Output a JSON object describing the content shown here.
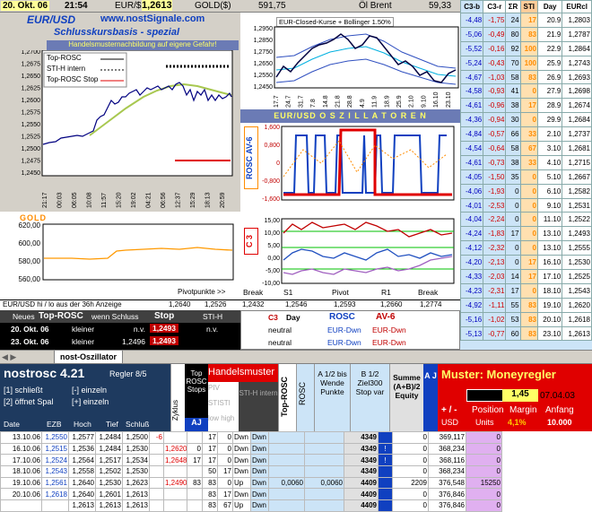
{
  "topbar": {
    "date": "20. Okt. 06",
    "time": "21:54",
    "eur_label": "EUR/$",
    "eur_value": "1,2613",
    "gold_label": "GOLD($)",
    "gold_value": "591,75",
    "oil_label": "Öl Brent",
    "oil_value": "59,33"
  },
  "main_chart": {
    "pair": "EUR/USD",
    "site": "www.nostSignale.com",
    "subtitle": "Schlusskursbasis - spezial",
    "banner": "Handelsmusternachbildung auf eigene Gefahr!",
    "legend": [
      "Top-ROSC",
      "STI-H intern",
      "Top-ROSC Stop"
    ],
    "yticks": [
      "1,2700",
      "1,2675",
      "1,2650",
      "1,2625",
      "1,2600",
      "1,2575",
      "1,2550",
      "1,2525",
      "1,2500",
      "1,2475",
      "1,2450"
    ],
    "xticks": [
      "21:17",
      "00:03",
      "06:05",
      "10:08",
      "11:57",
      "15:20",
      "19:02",
      "04:21",
      "06:56",
      "12:37",
      "15:29",
      "18:13",
      "20:59"
    ]
  },
  "gold_chart": {
    "title": "GOLD",
    "yticks": [
      "620,00",
      "600,00",
      "580,00",
      "560,00"
    ],
    "pivot_label": "Pivotpunkte >>"
  },
  "boll_chart": {
    "title": "EUR-Closed-Kurse + Bollinger 1.50%",
    "yticks": [
      "1,2950",
      "1,2850",
      "1,2750",
      "1,2650",
      "1,2550",
      "1,2450"
    ],
    "xticks": [
      "17.7",
      "24.7",
      "31.7",
      "7.8",
      "14.8",
      "21.8",
      "28.8",
      "4.9",
      "11.9",
      "18.9",
      "25.9",
      "2.10",
      "9.10",
      "16.10",
      "23.10"
    ]
  },
  "osc": {
    "title": "EUR/USD  O S Z I L L A T O R E N",
    "ylabel": "ROSC AV-6",
    "yticks": [
      "1,600",
      "0,800",
      "0",
      "-0,800",
      "-1,600"
    ],
    "c3_label": "C 3",
    "c3_yticks": [
      "15,00",
      "10,00",
      "5,00",
      "0,00",
      "-5,00",
      "-10,00"
    ],
    "pivot_cols": [
      "Break",
      "S1",
      "Pivot",
      "R1",
      "Break"
    ]
  },
  "hilo": {
    "label": "EUR/USD  hi / lo aus der 36h Anzeige",
    "hi": "1,2640",
    "lo": "1,2526",
    "vals": [
      "1,2432",
      "1,2546",
      "1,2593",
      "1,2660",
      "1,2774"
    ]
  },
  "signal": {
    "h1": "Neues",
    "h2": "Top-ROSC",
    "h3": "wenn Schluss",
    "h4": "Stop",
    "h5": "STI-H",
    "rows": [
      {
        "date": "20. Okt. 06",
        "cond": "kleiner",
        "val": "n.v.",
        "stop": "1,2493",
        "sti": "n.v."
      },
      {
        "date": "23. Okt. 06",
        "cond": "kleiner",
        "val": "1,2496",
        "stop": "1,2493",
        "sti": ""
      }
    ]
  },
  "c3day": {
    "h1": "C3",
    "h2": "Day",
    "h3": "ROSC",
    "h4": "AV-6",
    "rows": [
      [
        "neutral",
        "EUR-Dwn",
        "EUR-Dwn"
      ],
      [
        "neutral",
        "EUR-Dwn",
        "EUR-Dwn"
      ]
    ]
  },
  "right_table": {
    "headers": [
      "C3-b",
      "C3-r",
      "ΣR",
      "STI",
      "Day",
      "EURcl"
    ],
    "rows": [
      [
        "-4,48",
        "-1,75",
        "24",
        "17",
        "20.9",
        "1,2803"
      ],
      [
        "-5,06",
        "-0,49",
        "80",
        "83",
        "21.9",
        "1,2787"
      ],
      [
        "-5,52",
        "-0,16",
        "92",
        "100",
        "22.9",
        "1,2864"
      ],
      [
        "-5,24",
        "-0,43",
        "70",
        "100",
        "25.9",
        "1,2743"
      ],
      [
        "-4,67",
        "-1,03",
        "58",
        "83",
        "26.9",
        "1,2693"
      ],
      [
        "-4,58",
        "-0,93",
        "41",
        "0",
        "27.9",
        "1,2698"
      ],
      [
        "-4,61",
        "-0,96",
        "38",
        "17",
        "28.9",
        "1,2674"
      ],
      [
        "-4,36",
        "-0,94",
        "30",
        "0",
        "29.9",
        "1,2684"
      ],
      [
        "-4,84",
        "-0,57",
        "66",
        "33",
        "2.10",
        "1,2737"
      ],
      [
        "-4,54",
        "-0,64",
        "58",
        "67",
        "3.10",
        "1,2681"
      ],
      [
        "-4,61",
        "-0,73",
        "38",
        "33",
        "4.10",
        "1,2715"
      ],
      [
        "-4,05",
        "-1,50",
        "35",
        "0",
        "5.10",
        "1,2667"
      ],
      [
        "-4,06",
        "-1,93",
        "0",
        "0",
        "6.10",
        "1,2582"
      ],
      [
        "-4,01",
        "-2,53",
        "0",
        "0",
        "9.10",
        "1,2531"
      ],
      [
        "-4,04",
        "-2,24",
        "0",
        "0",
        "11.10",
        "1,2522"
      ],
      [
        "-4,24",
        "-1,83",
        "17",
        "0",
        "13.10",
        "1,2493"
      ],
      [
        "-4,12",
        "-2,32",
        "0",
        "0",
        "13.10",
        "1,2555"
      ],
      [
        "-4,20",
        "-2,13",
        "0",
        "17",
        "16.10",
        "1,2530"
      ],
      [
        "-4,33",
        "-2,03",
        "14",
        "17",
        "17.10",
        "1,2525"
      ],
      [
        "-4,23",
        "-2,31",
        "17",
        "0",
        "18.10",
        "1,2543"
      ],
      [
        "-4,92",
        "-1,11",
        "55",
        "83",
        "19.10",
        "1,2620"
      ],
      [
        "-5,16",
        "-1,02",
        "53",
        "83",
        "20.10",
        "1,2618"
      ],
      [
        "-5,13",
        "-0,77",
        "60",
        "83",
        "23.10",
        "1,2613"
      ]
    ]
  },
  "tabs": [
    "nost-Oszillator"
  ],
  "sheet": {
    "title": "nostrosc 4.21",
    "regler": "Regler 8/5",
    "opt1": "[1] schließt",
    "opt1b": "[-] einzeln",
    "opt2": "[2] öffnet Spal",
    "opt2b": "[+] einzeln",
    "cols": [
      "Date",
      "EZB",
      "Hoch",
      "Tief",
      "Schluß"
    ],
    "zyklus": "Zyklus",
    "toprosc": "Top ROSC Stops",
    "aj": "AJ",
    "piv": "PIV",
    "stisti": "STISTI",
    "lowhigh": "low high",
    "handelsmuster": "Handelsmuster",
    "stih": "STI-H intern",
    "toprosc_v": "Top-ROSC",
    "rosc_v": "ROSC",
    "a12": "A 1/2 bis Wende Punkte",
    "b12": "B 1/2 Ziel300 Stop var",
    "summe": "Summe (A+B)/2 Equity",
    "aj2": "A J",
    "muster": "Muster: Moneyregler",
    "val145": "1,45",
    "date_m": "07.04.03",
    "plusminus": "+ / -",
    "position": "Position",
    "usd": "USD",
    "units": "Units",
    "margin": "Margin",
    "pct": "4,1%",
    "anfang": "Anfang",
    "anfang_v": "10.000"
  },
  "sheet_rows": [
    [
      "13.10.06",
      "1,2550",
      "1,2577",
      "1,2484",
      "1,2500",
      "-6",
      "",
      "",
      "17",
      "0",
      "Dwn",
      "Dwn",
      "",
      "",
      "4349",
      "",
      "0",
      "369,117",
      "0"
    ],
    [
      "16.10.06",
      "1,2515",
      "1,2536",
      "1,2484",
      "1,2530",
      "",
      "1,2620",
      "0",
      "17",
      "0",
      "Dwn",
      "Dwn",
      "",
      "",
      "4349",
      "!",
      "0",
      "368,234",
      "0"
    ],
    [
      "17.10.06",
      "1,2524",
      "1,2564",
      "1,2517",
      "1,2534",
      "",
      "1,2648",
      "17",
      "17",
      "0",
      "Dwn",
      "Dwn",
      "",
      "",
      "4349",
      "!",
      "0",
      "368,116",
      "0"
    ],
    [
      "18.10.06",
      "1,2543",
      "1,2558",
      "1,2502",
      "1,2530",
      "",
      "",
      "",
      "50",
      "17",
      "Dwn",
      "Dwn",
      "",
      "",
      "4349",
      "",
      "0",
      "368,234",
      "0"
    ],
    [
      "19.10.06",
      "1,2561",
      "1,2640",
      "1,2530",
      "1,2623",
      "",
      "1,2490",
      "83",
      "83",
      "0",
      "Up",
      "Dwn",
      "0,0060",
      "0,0060",
      "4409",
      "",
      "2209",
      "376,548",
      "15250"
    ],
    [
      "20.10.06",
      "1,2618",
      "1,2640",
      "1,2601",
      "1,2613",
      "",
      "",
      "",
      "83",
      "17",
      "Dwn",
      "Dwn",
      "",
      "",
      "4409",
      "",
      "0",
      "376,846",
      "0"
    ],
    [
      "",
      "",
      "1,2613",
      "1,2613",
      "1,2613",
      "",
      "",
      "",
      "83",
      "67",
      "Up",
      "Dwn",
      "",
      "",
      "4409",
      "",
      "0",
      "376,846",
      "0"
    ]
  ]
}
